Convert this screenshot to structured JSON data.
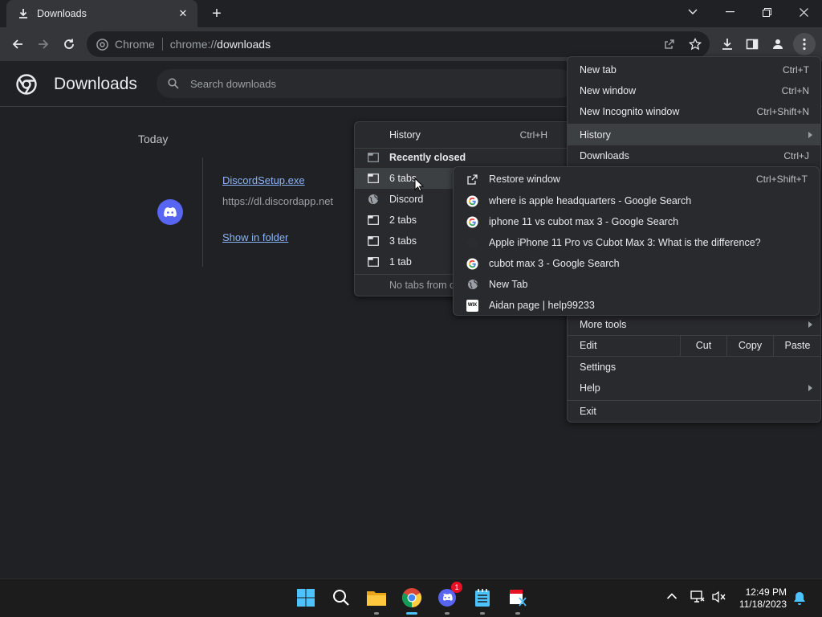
{
  "tab": {
    "title": "Downloads",
    "close_glyph": "✕"
  },
  "new_tab_glyph": "+",
  "omnibox": {
    "site_label": "Chrome",
    "url_prefix": "chrome://",
    "url_path": "downloads"
  },
  "page": {
    "title": "Downloads",
    "search_placeholder": "Search downloads"
  },
  "downloads": {
    "date_header": "Today",
    "items": [
      {
        "file_name": "DiscordSetup.exe",
        "url": "https://dl.discordapp.net",
        "action": "Show in folder"
      }
    ]
  },
  "main_menu": {
    "items": [
      {
        "label": "New tab",
        "shortcut": "Ctrl+T"
      },
      {
        "label": "New window",
        "shortcut": "Ctrl+N"
      },
      {
        "label": "New Incognito window",
        "shortcut": "Ctrl+Shift+N"
      },
      {
        "label": "History",
        "shortcut": ""
      },
      {
        "label": "Downloads",
        "shortcut": "Ctrl+J"
      },
      {
        "label": "More tools",
        "shortcut": ""
      },
      {
        "label": "Edit",
        "shortcut": ""
      },
      {
        "label": "Settings",
        "shortcut": ""
      },
      {
        "label": "Help",
        "shortcut": ""
      },
      {
        "label": "Exit",
        "shortcut": ""
      }
    ],
    "edit_actions": [
      "Cut",
      "Copy",
      "Paste"
    ]
  },
  "history_menu": {
    "items": [
      {
        "label": "History",
        "shortcut": "Ctrl+H",
        "icon": "none"
      },
      {
        "label": "Recently closed",
        "shortcut": "",
        "icon": "tab-icon"
      },
      {
        "label": "6 tabs",
        "shortcut": "",
        "icon": "tab-icon"
      },
      {
        "label": "Discord",
        "shortcut": "",
        "icon": "globe-icon"
      },
      {
        "label": "2 tabs",
        "shortcut": "",
        "icon": "tab-icon"
      },
      {
        "label": "3 tabs",
        "shortcut": "",
        "icon": "tab-icon"
      },
      {
        "label": "1 tab",
        "shortcut": "",
        "icon": "tab-icon"
      },
      {
        "label": "No tabs from other devices",
        "shortcut": "",
        "icon": "none"
      }
    ]
  },
  "tabs_menu": {
    "items": [
      {
        "label": "Restore window",
        "shortcut": "Ctrl+Shift+T",
        "icon": "open-external-icon"
      },
      {
        "label": "where is apple headquarters - Google Search",
        "shortcut": "",
        "icon": "google-icon"
      },
      {
        "label": "iphone 11 vs cubot max 3 - Google Search",
        "shortcut": "",
        "icon": "google-icon"
      },
      {
        "label": "Apple iPhone 11 Pro vs Cubot Max 3: What is the difference?",
        "shortcut": "",
        "icon": "blank-favicon"
      },
      {
        "label": "cubot max 3 - Google Search",
        "shortcut": "",
        "icon": "google-icon"
      },
      {
        "label": "New Tab",
        "shortcut": "",
        "icon": "globe-icon"
      },
      {
        "label": "Aidan page | help99233",
        "shortcut": "",
        "icon": "wix-icon"
      }
    ],
    "wix_text": "WIX"
  },
  "taskbar": {
    "time": "12:49 PM",
    "date": "11/18/2023",
    "discord_badge": "1"
  },
  "colors": {
    "background": "#202124",
    "toolbar": "#35363a",
    "menu": "#292a2d",
    "link": "#8ab4f8",
    "discord": "#5865f2",
    "highlight": "#3c4043"
  }
}
